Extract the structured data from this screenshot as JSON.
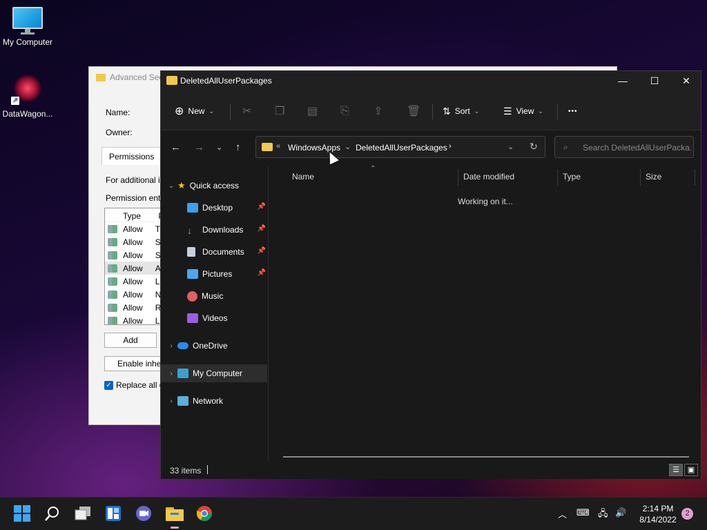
{
  "desktop": {
    "icons": [
      {
        "label": "My Computer"
      },
      {
        "label": "DataWagon..."
      }
    ]
  },
  "adv_dialog": {
    "title": "Advanced Sec",
    "name_label": "Name:",
    "owner_label": "Owner:",
    "tab": "Permissions",
    "info": "For additional i",
    "entries_label": "Permission entr",
    "list_header": "Type",
    "list_header2": "P",
    "rows": [
      {
        "type": "Allow",
        "p": "T"
      },
      {
        "type": "Allow",
        "p": "S"
      },
      {
        "type": "Allow",
        "p": "S"
      },
      {
        "type": "Allow",
        "p": "A"
      },
      {
        "type": "Allow",
        "p": "L"
      },
      {
        "type": "Allow",
        "p": "N"
      },
      {
        "type": "Allow",
        "p": "R"
      },
      {
        "type": "Allow",
        "p": "L"
      }
    ],
    "add_button": "Add",
    "enable_button": "Enable inhe",
    "replace_checkbox": "Replace all c"
  },
  "explorer": {
    "title": "DeletedAllUserPackages",
    "commands": {
      "new": "New",
      "sort": "Sort",
      "view": "View",
      "more": "•••"
    },
    "breadcrumb": [
      "WindowsApps",
      "DeletedAllUserPackages"
    ],
    "search_placeholder": "Search DeletedAllUserPacka...",
    "sidebar": {
      "quick_access": "Quick access",
      "items": [
        {
          "label": "Desktop",
          "color": "#3aa0f0"
        },
        {
          "label": "Downloads",
          "color": "#3ccf7e"
        },
        {
          "label": "Documents",
          "color": "#c8d0d8"
        },
        {
          "label": "Pictures",
          "color": "#4aa8f0"
        },
        {
          "label": "Music",
          "color": "#e06060"
        },
        {
          "label": "Videos",
          "color": "#9b5de5"
        }
      ],
      "onedrive": "OneDrive",
      "my_computer": "My Computer",
      "network": "Network"
    },
    "columns": [
      "Name",
      "Date modified",
      "Type",
      "Size"
    ],
    "working_text": "Working on it...",
    "status_items": "33 items"
  },
  "taskbar": {
    "time": "2:14 PM",
    "date": "8/14/2022",
    "notification_count": "2",
    "accent": "#e0a0d0"
  }
}
